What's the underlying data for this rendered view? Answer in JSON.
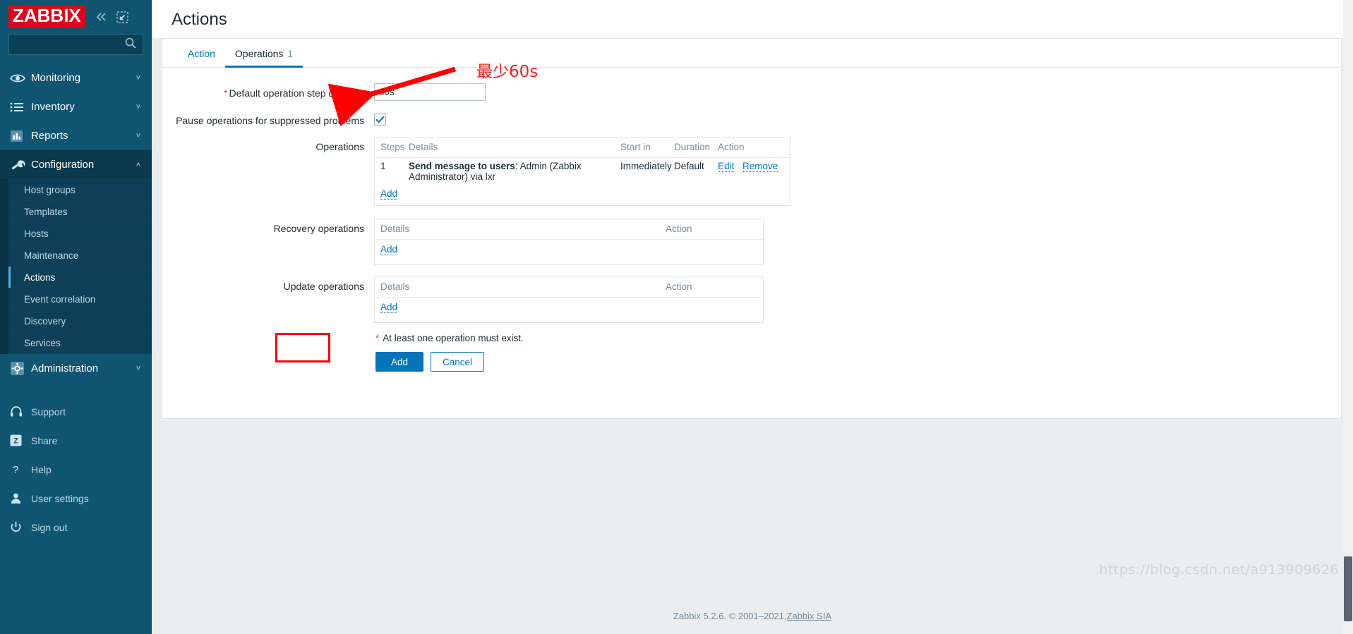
{
  "sidebar": {
    "logo": "ZABBIX",
    "collapse_icon": "chevron-double-left-icon",
    "expand_icon": "expand-view-icon",
    "search": {
      "value": "",
      "placeholder": ""
    },
    "nav": [
      {
        "label": "Monitoring",
        "icon": "eye-icon",
        "chevron": "˅",
        "open": false
      },
      {
        "label": "Inventory",
        "icon": "list-icon",
        "chevron": "˅",
        "open": false
      },
      {
        "label": "Reports",
        "icon": "bar-chart-icon",
        "chevron": "˅",
        "open": false
      },
      {
        "label": "Configuration",
        "icon": "wrench-icon",
        "chevron": "˄",
        "open": true
      },
      {
        "label": "Administration",
        "icon": "gear-icon",
        "chevron": "˅",
        "open": false
      }
    ],
    "configuration_submenu": [
      {
        "label": "Host groups",
        "selected": false
      },
      {
        "label": "Templates",
        "selected": false
      },
      {
        "label": "Hosts",
        "selected": false
      },
      {
        "label": "Maintenance",
        "selected": false
      },
      {
        "label": "Actions",
        "selected": true
      },
      {
        "label": "Event correlation",
        "selected": false
      },
      {
        "label": "Discovery",
        "selected": false
      },
      {
        "label": "Services",
        "selected": false
      }
    ],
    "footer_items": [
      {
        "label": "Support",
        "icon": "headset-icon"
      },
      {
        "label": "Share",
        "icon": "zabbix-share-icon"
      },
      {
        "label": "Help",
        "icon": "question-mark-icon"
      },
      {
        "label": "User settings",
        "icon": "person-icon"
      },
      {
        "label": "Sign out",
        "icon": "power-icon"
      }
    ]
  },
  "header": {
    "title": "Actions"
  },
  "tabs": [
    {
      "label": "Action",
      "count": "",
      "active": false
    },
    {
      "label": "Operations",
      "count": "1",
      "active": true
    }
  ],
  "form": {
    "duration": {
      "label": "Default operation step duration",
      "required_mark": "*",
      "value": "60s",
      "placeholder": ""
    },
    "pause": {
      "label": "Pause operations for suppressed problems",
      "checked": true
    },
    "operations": {
      "label": "Operations",
      "headers": [
        "Steps",
        "Details",
        "Start in",
        "Duration",
        "Action"
      ],
      "rows": [
        {
          "steps": "1",
          "details_bold": "Send message to users",
          "details_rest": ": Admin (Zabbix Administrator) via lxr",
          "start_in": "Immediately",
          "duration": "Default",
          "edit": "Edit",
          "remove": "Remove"
        }
      ],
      "add_label": "Add"
    },
    "recovery_operations": {
      "label": "Recovery operations",
      "headers": [
        "Details",
        "Action"
      ],
      "rows": [],
      "add_label": "Add"
    },
    "update_operations": {
      "label": "Update operations",
      "headers": [
        "Details",
        "Action"
      ],
      "rows": [],
      "add_label": "Add"
    },
    "note": "At least one operation must exist.",
    "note_mark": "*",
    "buttons": {
      "add": "Add",
      "cancel": "Cancel"
    }
  },
  "annotations": {
    "duration_note": "最少60s",
    "accent_red": "#ff0000"
  },
  "footer": {
    "text": "Zabbix 5.2.6. © 2001–2021, ",
    "link": "Zabbix SIA"
  },
  "watermark": "https://blog.csdn.net/a913909626"
}
